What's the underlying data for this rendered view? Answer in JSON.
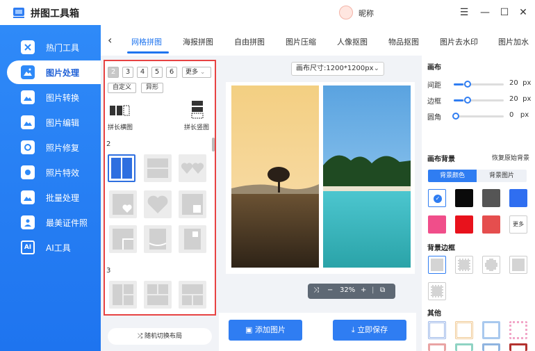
{
  "app": {
    "title": "拼图工具箱",
    "nickname": "昵称"
  },
  "window": {
    "menu": "☰",
    "minimize": "—",
    "maximize": "☐",
    "close": "✕"
  },
  "sidebar": {
    "items": [
      {
        "label": "热门工具",
        "icon": "hot-tools-icon"
      },
      {
        "label": "图片处理",
        "icon": "image-process-icon",
        "active": true
      },
      {
        "label": "图片转换",
        "icon": "image-convert-icon"
      },
      {
        "label": "图片编辑",
        "icon": "image-edit-icon"
      },
      {
        "label": "照片修复",
        "icon": "photo-repair-icon"
      },
      {
        "label": "照片特效",
        "icon": "photo-effect-icon"
      },
      {
        "label": "批量处理",
        "icon": "batch-icon"
      },
      {
        "label": "最美证件照",
        "icon": "id-photo-icon"
      },
      {
        "label": "AI工具",
        "icon": "ai-icon",
        "badge": "AI"
      }
    ]
  },
  "tabs": {
    "back": "‹",
    "items": [
      "网格拼图",
      "海报拼图",
      "自由拼图",
      "图片压缩",
      "人像抠图",
      "物品抠图",
      "图片去水印",
      "图片加水"
    ],
    "active": "网格拼图"
  },
  "layout_panel": {
    "counts": [
      "2",
      "3",
      "4",
      "5",
      "6"
    ],
    "selected_count": "2",
    "more": "更多",
    "custom": "自定义",
    "irregular": "异形",
    "long_horizontal": "拼长横图",
    "long_vertical": "拼长竖图",
    "section_2": "2",
    "section_3": "3"
  },
  "random_layout": "随机切换布局",
  "canvas": {
    "size": "画布尺寸:1200*1200px",
    "zoom": "32%"
  },
  "actions": {
    "add_image": "添加图片",
    "save_now": "立即保存"
  },
  "right_panel": {
    "canvas_title": "画布",
    "spacing": {
      "label": "间距",
      "value": "20",
      "unit": "px",
      "fraction": 0.2
    },
    "border": {
      "label": "边框",
      "value": "20",
      "unit": "px",
      "fraction": 0.2
    },
    "radius": {
      "label": "圆角",
      "value": "0",
      "unit": "px",
      "fraction": 0
    },
    "bg_title": "画布背景",
    "reset": "恢复原始背景",
    "bg_color_tab": "背景颜色",
    "bg_image_tab": "背景图片",
    "colors": [
      "#ffffff",
      "#0a0a0a",
      "#555555",
      "#2f6ef0",
      "#f04e8a",
      "#e8121c",
      "#e54e4e"
    ],
    "more_colors": "更多",
    "bg_border_title": "背景边框",
    "other_title": "其他"
  }
}
